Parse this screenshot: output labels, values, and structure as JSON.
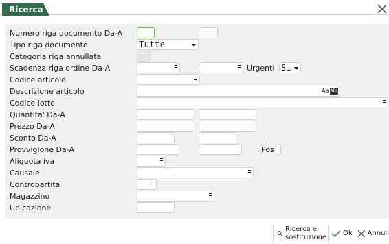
{
  "dialog": {
    "title": "Ricerca",
    "accent_color": "#2f6d4c",
    "close_icon": "close-icon"
  },
  "fields": {
    "numero_riga": {
      "label": "Numero riga documento Da-A"
    },
    "tipo_riga": {
      "label": "Tipo riga documento",
      "value": "Tutte"
    },
    "categoria_annullata": {
      "label": "Categoria riga annullata"
    },
    "scadenza": {
      "label": "Scadenza riga ordine Da-A",
      "urgenti_label": "Urgenti",
      "urgenti_value": "Si"
    },
    "codice_articolo": {
      "label": "Codice articolo"
    },
    "descrizione_articolo": {
      "label": "Descrizione articolo",
      "aa_icon": "Aa",
      "abc_icon": "Abc"
    },
    "codice_lotto": {
      "label": "Codice lotto"
    },
    "quantita": {
      "label": "Quantita' Da-A"
    },
    "prezzo": {
      "label": "Prezzo Da-A"
    },
    "sconto": {
      "label": "Sconto Da-A"
    },
    "provvigione": {
      "label": "Provvigione Da-A",
      "pos_label": "Pos"
    },
    "aliquota_iva": {
      "label": "Aliquota iva"
    },
    "causale": {
      "label": "Causale"
    },
    "contropartita": {
      "label": "Contropartita"
    },
    "magazzino": {
      "label": "Magazzino"
    },
    "ubicazione": {
      "label": "Ubicazione"
    }
  },
  "footer": {
    "search_replace_line1": "Ricerca e",
    "search_replace_line2": "sostituzione",
    "ok_label": "Ok",
    "cancel_label": "Annull"
  }
}
